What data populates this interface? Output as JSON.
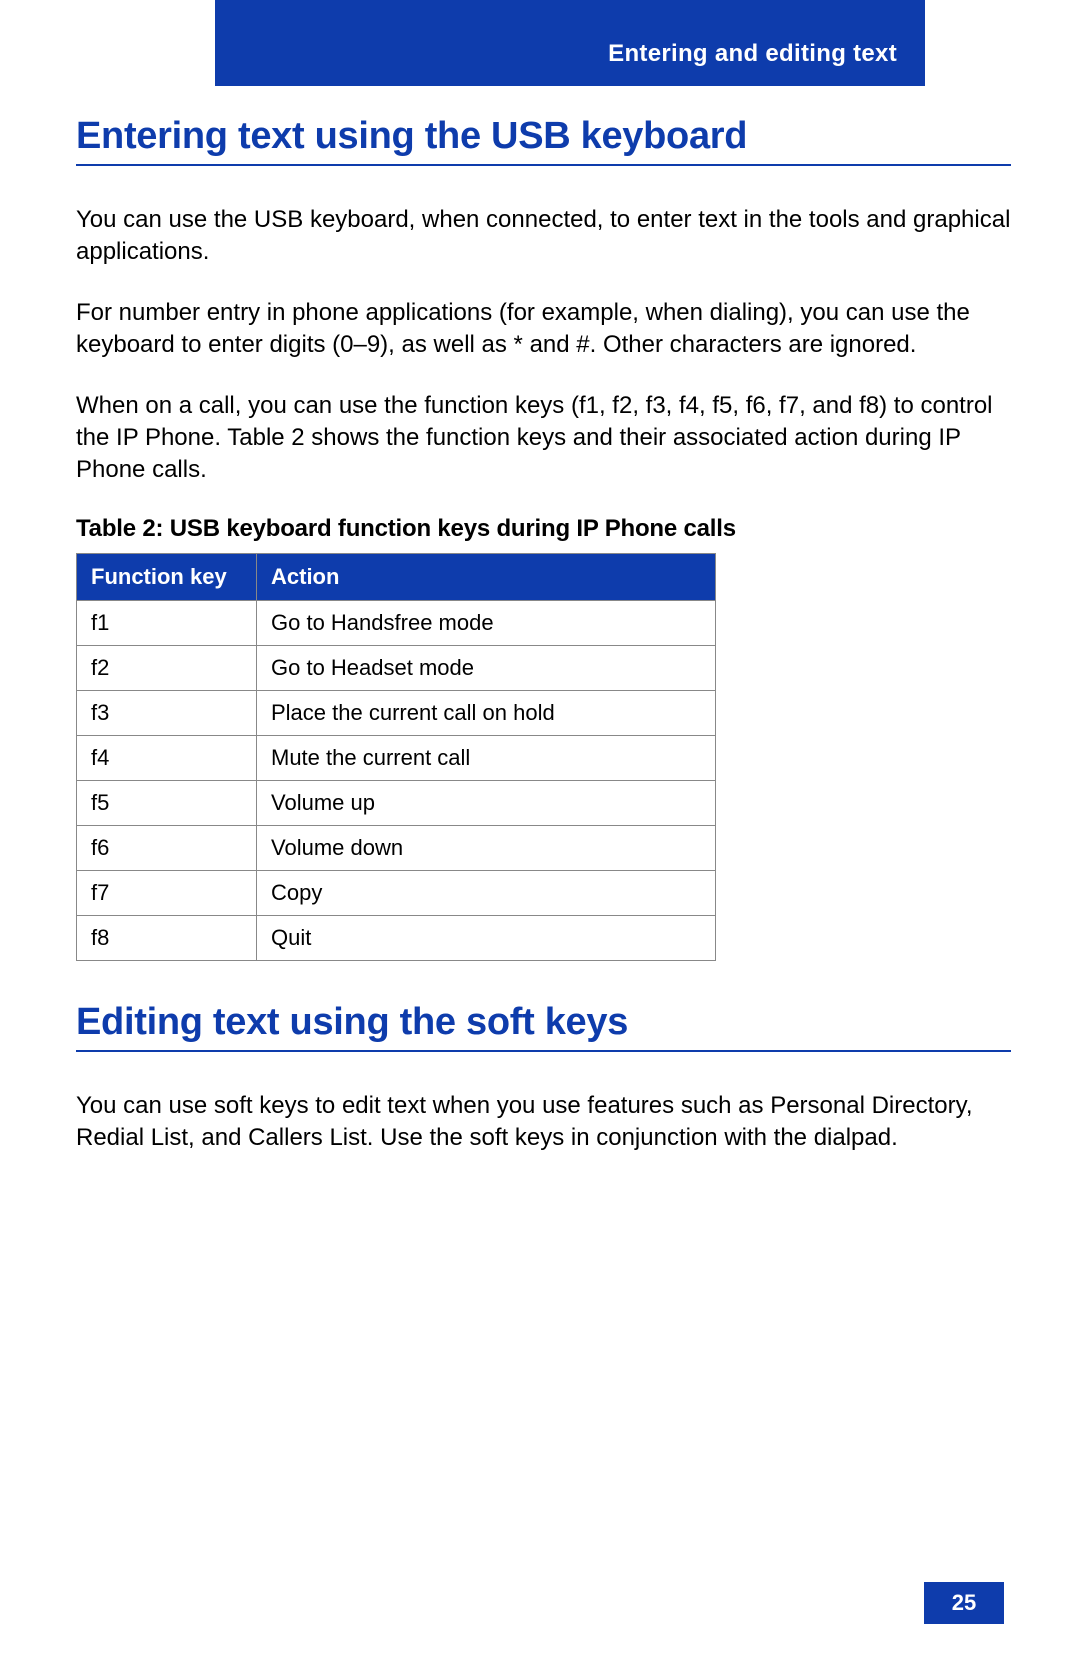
{
  "header": {
    "section_title": "Entering and editing text"
  },
  "section1": {
    "heading": "Entering text using the USB keyboard",
    "para1": "You can use the USB keyboard, when connected, to enter text in the tools and graphical applications.",
    "para2": "For number entry in phone applications (for example, when dialing), you can use the keyboard to enter digits (0–9), as well as * and #. Other characters are ignored.",
    "para3": "When on a call, you can use the function keys (f1, f2, f3, f4, f5, f6, f7, and f8) to control the IP Phone. Table 2 shows the function keys and their associated action during IP Phone calls."
  },
  "table2": {
    "caption": "Table 2: USB keyboard function keys during IP Phone calls",
    "headers": {
      "col1": "Function key",
      "col2": "Action"
    },
    "rows": [
      {
        "key": "f1",
        "action": "Go to Handsfree mode"
      },
      {
        "key": "f2",
        "action": "Go to Headset mode"
      },
      {
        "key": "f3",
        "action": "Place the current call on hold"
      },
      {
        "key": "f4",
        "action": "Mute the current call"
      },
      {
        "key": "f5",
        "action": "Volume up"
      },
      {
        "key": "f6",
        "action": "Volume down"
      },
      {
        "key": "f7",
        "action": "Copy"
      },
      {
        "key": "f8",
        "action": "Quit"
      }
    ]
  },
  "section2": {
    "heading": "Editing text using the soft keys",
    "para1": "You can use soft keys to edit text when you use features such as Personal Directory, Redial List, and Callers List. Use the soft keys in conjunction with the dialpad."
  },
  "page_number": "25"
}
